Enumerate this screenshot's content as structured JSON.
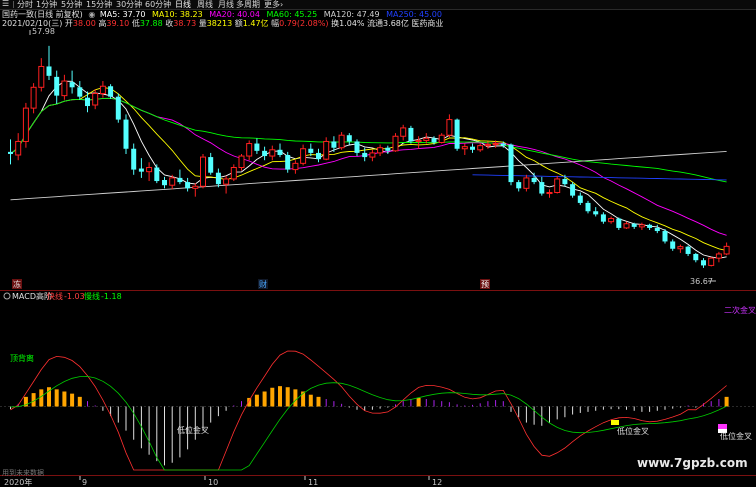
{
  "toolbar": {
    "items": [
      "分时",
      "1分钟",
      "5分钟",
      "15分钟",
      "30分钟",
      "60分钟",
      "日线",
      "周线",
      "月线",
      "多周期",
      "更多"
    ],
    "more_suffix": "›"
  },
  "header": {
    "stock_title": "国药一致(日线 前复权)",
    "ma": [
      {
        "label": "MA5: 37.70",
        "color": "#ffffff"
      },
      {
        "label": "MA10: 38.23",
        "color": "#ffff00"
      },
      {
        "label": "MA20: 40.04",
        "color": "#ff00ff"
      },
      {
        "label": "MA60: 45.25",
        "color": "#00ff00"
      },
      {
        "label": "MA120: 47.49",
        "color": "#d0d0d0"
      }
    ],
    "ma_extra": "MA250: 45.00"
  },
  "quote": {
    "date": "2021/02/10(三)",
    "open_label": "开",
    "open": "38.00",
    "high_label": "高",
    "high": "39.10",
    "low_label": "低",
    "low": "37.88",
    "close_label": "收",
    "close": "38.73",
    "volume_label": "量",
    "volume": "38213",
    "amount_label": "额",
    "amount": "1.47亿",
    "change_label": "幅",
    "change": "0.79(2.08%)",
    "turnover": "换1.04%",
    "float_cap": "流通3.68亿",
    "sector": "医药商业"
  },
  "price_panel": {
    "high_marker": "57.98",
    "low_marker": "36.67",
    "event_markers": [
      {
        "text": "冻",
        "color": "#e8e8e8",
        "bg": "#6a1010"
      },
      {
        "text": "财",
        "color": "#4aa8ff",
        "bg": "#101828"
      },
      {
        "text": "预",
        "color": "#ffffff",
        "bg": "#6a1010"
      }
    ]
  },
  "macd_panel": {
    "title": "MACD高阶",
    "fast_label": "快线",
    "fast_value": "-1.03",
    "slow_label": "慢线",
    "slow_value": "-1.18",
    "annotations": [
      "二次金叉",
      "顶背离",
      "低位金叉",
      "低位金叉",
      "低位金叉"
    ]
  },
  "footer": {
    "caption": "用到未来数据",
    "year": "2020年",
    "months": [
      "9",
      "10",
      "11",
      "12"
    ],
    "watermark": "www.7gpzb.com"
  },
  "colors": {
    "up_candle": "#ff2020",
    "down_candle": "#54ffff",
    "ma5": "#ffffff",
    "ma10": "#ffff00",
    "ma20": "#ff00ff",
    "ma60": "#00ff00",
    "ma120": "#d0d0d0",
    "ma250": "#2040ff",
    "macd_orange": "#ffa500",
    "macd_purple": "#aa22ee",
    "macd_white": "#e0e0e0"
  },
  "chart_data": {
    "type": "candlestick",
    "title": "国药一致(日线 前复权)",
    "x_label": "",
    "y_label": "",
    "ylim": [
      35.5,
      59.5
    ],
    "candles": [
      [
        47.8,
        49.0,
        46.6,
        47.6
      ],
      [
        47.5,
        49.6,
        47.0,
        48.8
      ],
      [
        48.8,
        52.5,
        48.2,
        52.0
      ],
      [
        52.0,
        54.4,
        51.5,
        54.0
      ],
      [
        54.0,
        56.8,
        53.6,
        56.0
      ],
      [
        56.0,
        57.98,
        54.7,
        55.1
      ],
      [
        55.0,
        55.6,
        52.4,
        53.2
      ],
      [
        53.2,
        55.2,
        52.8,
        54.6
      ],
      [
        54.5,
        55.6,
        53.4,
        54.0
      ],
      [
        54.0,
        54.6,
        52.8,
        53.1
      ],
      [
        53.0,
        53.6,
        51.6,
        52.2
      ],
      [
        52.3,
        53.8,
        51.9,
        53.4
      ],
      [
        53.4,
        54.6,
        53.0,
        54.1
      ],
      [
        54.1,
        54.3,
        52.9,
        53.1
      ],
      [
        53.1,
        53.4,
        50.6,
        50.9
      ],
      [
        50.9,
        51.4,
        47.6,
        48.1
      ],
      [
        48.1,
        48.6,
        45.6,
        46.1
      ],
      [
        46.2,
        47.2,
        45.3,
        45.9
      ],
      [
        45.9,
        46.8,
        45.0,
        46.3
      ],
      [
        46.3,
        46.6,
        44.8,
        45.0
      ],
      [
        45.1,
        45.4,
        44.3,
        44.6
      ],
      [
        44.6,
        45.6,
        44.2,
        45.3
      ],
      [
        45.3,
        46.1,
        44.7,
        44.9
      ],
      [
        44.9,
        45.3,
        44.0,
        44.3
      ],
      [
        44.3,
        44.8,
        43.5,
        44.5
      ],
      [
        44.5,
        47.6,
        44.3,
        47.3
      ],
      [
        47.3,
        47.7,
        45.6,
        45.8
      ],
      [
        45.8,
        46.2,
        44.4,
        44.7
      ],
      [
        44.7,
        45.5,
        43.8,
        45.2
      ],
      [
        45.2,
        46.6,
        45.0,
        46.3
      ],
      [
        46.3,
        47.6,
        46.0,
        47.4
      ],
      [
        47.4,
        48.9,
        47.0,
        48.6
      ],
      [
        48.6,
        49.1,
        47.6,
        47.9
      ],
      [
        47.9,
        48.3,
        47.0,
        47.4
      ],
      [
        47.4,
        48.4,
        47.0,
        48.0
      ],
      [
        48.0,
        48.6,
        47.3,
        47.5
      ],
      [
        47.5,
        47.8,
        45.8,
        46.1
      ],
      [
        46.1,
        47.0,
        45.7,
        46.7
      ],
      [
        46.7,
        48.5,
        46.5,
        48.1
      ],
      [
        48.1,
        48.6,
        47.4,
        47.7
      ],
      [
        47.7,
        48.1,
        46.8,
        47.1
      ],
      [
        47.1,
        49.2,
        47.0,
        48.8
      ],
      [
        48.8,
        49.3,
        47.8,
        48.2
      ],
      [
        48.2,
        49.7,
        48.0,
        49.4
      ],
      [
        49.4,
        49.6,
        48.5,
        48.8
      ],
      [
        48.8,
        49.0,
        47.4,
        47.7
      ],
      [
        47.7,
        48.2,
        46.9,
        47.3
      ],
      [
        47.3,
        48.0,
        46.9,
        47.7
      ],
      [
        47.7,
        48.5,
        47.4,
        48.2
      ],
      [
        48.2,
        48.4,
        47.6,
        47.9
      ],
      [
        47.9,
        49.6,
        47.8,
        49.3
      ],
      [
        49.3,
        50.4,
        48.9,
        50.1
      ],
      [
        50.1,
        50.3,
        48.6,
        48.8
      ],
      [
        48.8,
        49.3,
        48.1,
        48.9
      ],
      [
        48.9,
        49.6,
        48.6,
        49.1
      ],
      [
        49.1,
        49.3,
        48.5,
        48.7
      ],
      [
        48.7,
        49.6,
        48.6,
        49.4
      ],
      [
        49.4,
        51.4,
        49.2,
        50.9
      ],
      [
        50.9,
        51.0,
        47.9,
        48.1
      ],
      [
        48.1,
        48.6,
        47.5,
        48.3
      ],
      [
        48.3,
        48.6,
        47.7,
        48.0
      ],
      [
        48.0,
        48.6,
        47.8,
        48.4
      ],
      [
        48.4,
        48.8,
        48.1,
        48.5
      ],
      [
        48.5,
        48.9,
        48.2,
        48.6
      ],
      [
        48.6,
        48.8,
        48.2,
        48.4
      ],
      [
        48.5,
        48.6,
        44.6,
        44.9
      ],
      [
        44.9,
        45.1,
        44.0,
        44.3
      ],
      [
        44.3,
        45.6,
        44.0,
        45.3
      ],
      [
        45.3,
        45.8,
        44.7,
        44.9
      ],
      [
        44.9,
        45.4,
        43.6,
        43.8
      ],
      [
        43.8,
        44.2,
        43.4,
        43.9
      ],
      [
        43.9,
        45.5,
        43.8,
        45.2
      ],
      [
        45.2,
        45.6,
        44.5,
        44.7
      ],
      [
        44.7,
        44.9,
        43.4,
        43.6
      ],
      [
        43.6,
        43.9,
        42.7,
        42.9
      ],
      [
        42.9,
        43.1,
        41.9,
        42.1
      ],
      [
        42.1,
        42.5,
        41.6,
        41.8
      ],
      [
        41.8,
        42.0,
        40.9,
        41.1
      ],
      [
        41.1,
        41.6,
        40.9,
        41.4
      ],
      [
        41.4,
        41.5,
        40.3,
        40.5
      ],
      [
        40.5,
        41.1,
        40.4,
        40.9
      ],
      [
        40.9,
        41.0,
        40.4,
        40.6
      ],
      [
        40.6,
        41.0,
        40.3,
        40.8
      ],
      [
        40.8,
        40.9,
        40.3,
        40.5
      ],
      [
        40.5,
        40.8,
        40.0,
        40.2
      ],
      [
        40.2,
        40.4,
        39.0,
        39.2
      ],
      [
        39.2,
        39.4,
        38.3,
        38.5
      ],
      [
        38.5,
        38.9,
        38.1,
        38.7
      ],
      [
        38.7,
        38.8,
        37.8,
        38.0
      ],
      [
        38.0,
        38.1,
        37.2,
        37.4
      ],
      [
        37.4,
        37.6,
        36.67,
        36.9
      ],
      [
        36.9,
        37.7,
        36.8,
        37.6
      ],
      [
        37.6,
        38.2,
        37.2,
        38.0
      ],
      [
        38.0,
        39.1,
        37.88,
        38.73
      ]
    ],
    "macd_range": [
      -1.6,
      1.2
    ],
    "macd_hist": [
      -0.05,
      0.05,
      0.18,
      0.25,
      0.32,
      0.36,
      0.32,
      0.28,
      0.24,
      0.18,
      0.1,
      0.02,
      -0.08,
      -0.18,
      -0.3,
      -0.45,
      -0.62,
      -0.78,
      -0.9,
      -1.02,
      -1.1,
      -1.05,
      -0.95,
      -0.8,
      -0.62,
      -0.45,
      -0.3,
      -0.18,
      -0.08,
      0.02,
      0.1,
      0.16,
      0.22,
      0.28,
      0.35,
      0.38,
      0.36,
      0.32,
      0.28,
      0.22,
      0.18,
      0.14,
      0.1,
      0.05,
      -0.02,
      -0.06,
      -0.08,
      -0.06,
      -0.04,
      -0.02,
      0.04,
      0.1,
      0.14,
      0.16,
      0.14,
      0.12,
      0.1,
      0.08,
      0.04,
      0.02,
      0.03,
      0.06,
      0.1,
      0.12,
      0.1,
      -0.1,
      -0.2,
      -0.3,
      -0.34,
      -0.36,
      -0.3,
      -0.24,
      -0.2,
      -0.15,
      -0.12,
      -0.1,
      -0.08,
      -0.06,
      -0.05,
      -0.05,
      -0.06,
      -0.08,
      -0.1,
      -0.1,
      -0.08,
      -0.06,
      -0.04,
      -0.02,
      0.02,
      -0.02,
      0.06,
      0.1,
      0.14,
      0.18
    ]
  }
}
